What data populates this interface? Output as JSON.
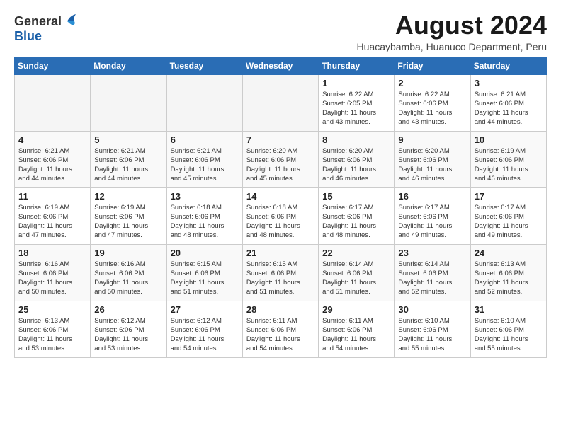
{
  "header": {
    "logo_line1": "General",
    "logo_line2": "Blue",
    "month_year": "August 2024",
    "location": "Huacaybamba, Huanuco Department, Peru"
  },
  "weekdays": [
    "Sunday",
    "Monday",
    "Tuesday",
    "Wednesday",
    "Thursday",
    "Friday",
    "Saturday"
  ],
  "weeks": [
    [
      {
        "day": "",
        "info": ""
      },
      {
        "day": "",
        "info": ""
      },
      {
        "day": "",
        "info": ""
      },
      {
        "day": "",
        "info": ""
      },
      {
        "day": "1",
        "info": "Sunrise: 6:22 AM\nSunset: 6:05 PM\nDaylight: 11 hours\nand 43 minutes."
      },
      {
        "day": "2",
        "info": "Sunrise: 6:22 AM\nSunset: 6:06 PM\nDaylight: 11 hours\nand 43 minutes."
      },
      {
        "day": "3",
        "info": "Sunrise: 6:21 AM\nSunset: 6:06 PM\nDaylight: 11 hours\nand 44 minutes."
      }
    ],
    [
      {
        "day": "4",
        "info": "Sunrise: 6:21 AM\nSunset: 6:06 PM\nDaylight: 11 hours\nand 44 minutes."
      },
      {
        "day": "5",
        "info": "Sunrise: 6:21 AM\nSunset: 6:06 PM\nDaylight: 11 hours\nand 44 minutes."
      },
      {
        "day": "6",
        "info": "Sunrise: 6:21 AM\nSunset: 6:06 PM\nDaylight: 11 hours\nand 45 minutes."
      },
      {
        "day": "7",
        "info": "Sunrise: 6:20 AM\nSunset: 6:06 PM\nDaylight: 11 hours\nand 45 minutes."
      },
      {
        "day": "8",
        "info": "Sunrise: 6:20 AM\nSunset: 6:06 PM\nDaylight: 11 hours\nand 46 minutes."
      },
      {
        "day": "9",
        "info": "Sunrise: 6:20 AM\nSunset: 6:06 PM\nDaylight: 11 hours\nand 46 minutes."
      },
      {
        "day": "10",
        "info": "Sunrise: 6:19 AM\nSunset: 6:06 PM\nDaylight: 11 hours\nand 46 minutes."
      }
    ],
    [
      {
        "day": "11",
        "info": "Sunrise: 6:19 AM\nSunset: 6:06 PM\nDaylight: 11 hours\nand 47 minutes."
      },
      {
        "day": "12",
        "info": "Sunrise: 6:19 AM\nSunset: 6:06 PM\nDaylight: 11 hours\nand 47 minutes."
      },
      {
        "day": "13",
        "info": "Sunrise: 6:18 AM\nSunset: 6:06 PM\nDaylight: 11 hours\nand 48 minutes."
      },
      {
        "day": "14",
        "info": "Sunrise: 6:18 AM\nSunset: 6:06 PM\nDaylight: 11 hours\nand 48 minutes."
      },
      {
        "day": "15",
        "info": "Sunrise: 6:17 AM\nSunset: 6:06 PM\nDaylight: 11 hours\nand 48 minutes."
      },
      {
        "day": "16",
        "info": "Sunrise: 6:17 AM\nSunset: 6:06 PM\nDaylight: 11 hours\nand 49 minutes."
      },
      {
        "day": "17",
        "info": "Sunrise: 6:17 AM\nSunset: 6:06 PM\nDaylight: 11 hours\nand 49 minutes."
      }
    ],
    [
      {
        "day": "18",
        "info": "Sunrise: 6:16 AM\nSunset: 6:06 PM\nDaylight: 11 hours\nand 50 minutes."
      },
      {
        "day": "19",
        "info": "Sunrise: 6:16 AM\nSunset: 6:06 PM\nDaylight: 11 hours\nand 50 minutes."
      },
      {
        "day": "20",
        "info": "Sunrise: 6:15 AM\nSunset: 6:06 PM\nDaylight: 11 hours\nand 51 minutes."
      },
      {
        "day": "21",
        "info": "Sunrise: 6:15 AM\nSunset: 6:06 PM\nDaylight: 11 hours\nand 51 minutes."
      },
      {
        "day": "22",
        "info": "Sunrise: 6:14 AM\nSunset: 6:06 PM\nDaylight: 11 hours\nand 51 minutes."
      },
      {
        "day": "23",
        "info": "Sunrise: 6:14 AM\nSunset: 6:06 PM\nDaylight: 11 hours\nand 52 minutes."
      },
      {
        "day": "24",
        "info": "Sunrise: 6:13 AM\nSunset: 6:06 PM\nDaylight: 11 hours\nand 52 minutes."
      }
    ],
    [
      {
        "day": "25",
        "info": "Sunrise: 6:13 AM\nSunset: 6:06 PM\nDaylight: 11 hours\nand 53 minutes."
      },
      {
        "day": "26",
        "info": "Sunrise: 6:12 AM\nSunset: 6:06 PM\nDaylight: 11 hours\nand 53 minutes."
      },
      {
        "day": "27",
        "info": "Sunrise: 6:12 AM\nSunset: 6:06 PM\nDaylight: 11 hours\nand 54 minutes."
      },
      {
        "day": "28",
        "info": "Sunrise: 6:11 AM\nSunset: 6:06 PM\nDaylight: 11 hours\nand 54 minutes."
      },
      {
        "day": "29",
        "info": "Sunrise: 6:11 AM\nSunset: 6:06 PM\nDaylight: 11 hours\nand 54 minutes."
      },
      {
        "day": "30",
        "info": "Sunrise: 6:10 AM\nSunset: 6:06 PM\nDaylight: 11 hours\nand 55 minutes."
      },
      {
        "day": "31",
        "info": "Sunrise: 6:10 AM\nSunset: 6:06 PM\nDaylight: 11 hours\nand 55 minutes."
      }
    ]
  ]
}
